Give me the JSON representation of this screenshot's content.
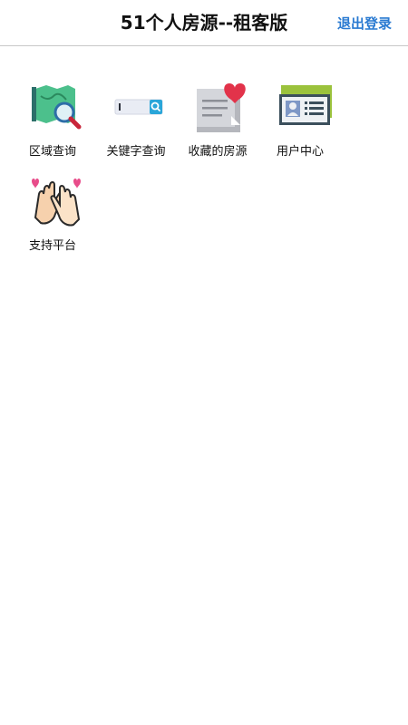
{
  "header": {
    "title": "51个人房源--租客版",
    "logout_label": "退出登录"
  },
  "menu": {
    "items": [
      {
        "label": "区域查询",
        "icon": "map-search-icon"
      },
      {
        "label": "关键字查询",
        "icon": "keyword-search-icon"
      },
      {
        "label": "收藏的房源",
        "icon": "favorite-document-icon"
      },
      {
        "label": "用户中心",
        "icon": "user-card-icon"
      },
      {
        "label": "支持平台",
        "icon": "clapping-hands-icon"
      }
    ]
  },
  "colors": {
    "accent": "#2a7ad1",
    "header_border": "#c8c8c8",
    "heart": "#e2334a",
    "map_green": "#3fb37f"
  }
}
